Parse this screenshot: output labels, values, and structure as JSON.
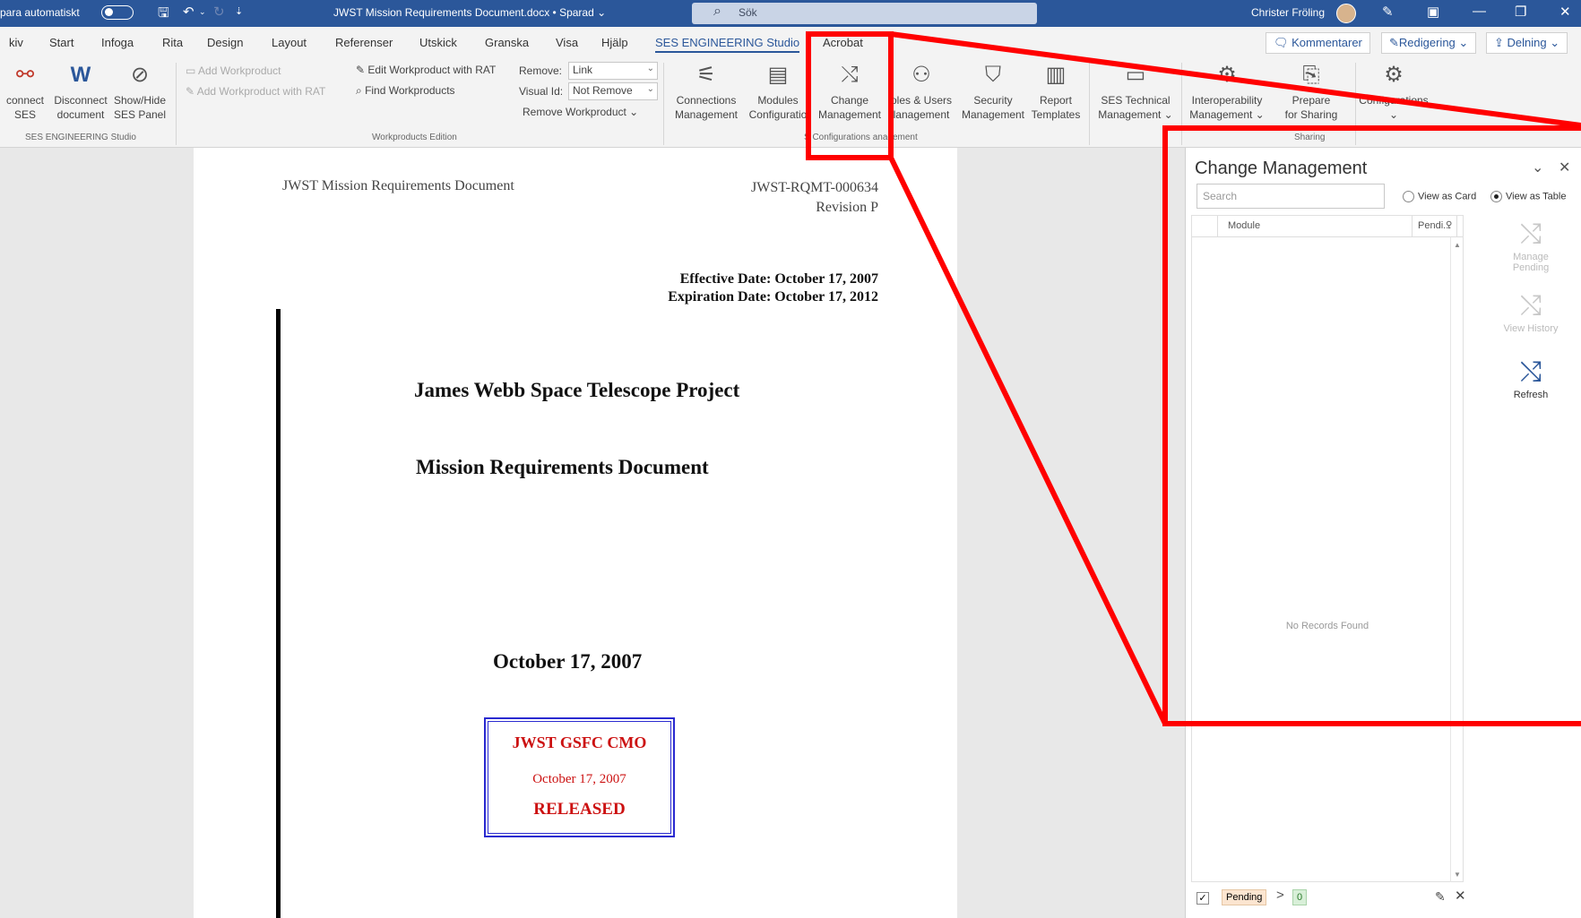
{
  "titlebar": {
    "autosave": "para automatiskt",
    "doc_title": "JWST Mission Requirements Document.docx • Sparad",
    "search_placeholder": "Sök",
    "user": "Christer Fröling"
  },
  "tabs": [
    "kiv",
    "Start",
    "Infoga",
    "Rita",
    "Design",
    "Layout",
    "Referenser",
    "Utskick",
    "Granska",
    "Visa",
    "Hjälp",
    "SES ENGINEERING Studio",
    "Acrobat"
  ],
  "tab_buttons": {
    "comments": "Kommentarer",
    "editing": "Redigering",
    "share": "Delning"
  },
  "ribbon": {
    "ses_group": {
      "buttons": [
        {
          "l1": "connect",
          "l2": "SES"
        },
        {
          "l1": "Disconnect",
          "l2": "document"
        },
        {
          "l1": "Show/Hide",
          "l2": "SES Panel"
        }
      ],
      "label": "SES ENGINEERING Studio"
    },
    "workproducts": {
      "add": "Add Workproduct",
      "add_rat": "Add Workproduct with RAT",
      "edit_rat": "Edit Workproduct with RAT",
      "find": "Find Workproducts",
      "remove_label": "Remove:",
      "remove_value": "Link",
      "visual_label": "Visual Id:",
      "visual_value": "Not Remove",
      "remove_wp": "Remove Workproduct",
      "label": "Workproducts Edition"
    },
    "config": {
      "buttons": [
        {
          "l1": "Connections",
          "l2": "Management"
        },
        {
          "l1": "Modules",
          "l2": "Configuratio"
        },
        {
          "l1": "Change",
          "l2": "Management"
        },
        {
          "l1": "oles & Users",
          "l2": "lanagement"
        },
        {
          "l1": "Security",
          "l2": "Management"
        },
        {
          "l1": "Report",
          "l2": "Templates"
        }
      ],
      "label": "SES Configurations Management",
      "label_visible": "S Configurations   anagement"
    },
    "tech": {
      "l1": "SES Technical",
      "l2": "Management"
    },
    "interop": {
      "l1": "Interoperability",
      "l2": "Management"
    },
    "sharing": {
      "l1": "Prepare",
      "l2": "for Sharing",
      "label": "Sharing"
    },
    "configurations": "Configurations"
  },
  "document": {
    "header_left": "JWST Mission Requirements Document",
    "doc_id": "JWST-RQMT-000634",
    "revision": "Revision P",
    "effective": "Effective Date: October 17, 2007",
    "expiration": "Expiration Date: October 17, 2012",
    "project": "James Webb Space Telescope Project",
    "doc_name": "Mission Requirements Document",
    "date": "October 17, 2007",
    "stamp": {
      "org": "JWST GSFC CMO",
      "date": "October 17, 2007",
      "status": "RELEASED"
    }
  },
  "panel": {
    "title": "Change Management",
    "search_placeholder": "Search",
    "view_card": "View as Card",
    "view_table": "View as Table",
    "view_selected": "table",
    "columns": [
      "Module",
      "Pendi..."
    ],
    "empty": "No Records Found",
    "actions": [
      {
        "l1": "Manage",
        "l2": "Pending",
        "enabled": false
      },
      {
        "l1": "View History",
        "l2": "",
        "enabled": false
      },
      {
        "l1": "Refresh",
        "l2": "",
        "enabled": true
      }
    ],
    "filter": {
      "label": "Pending",
      "count": "0"
    }
  },
  "colors": {
    "brand": "#2b579a",
    "annotation": "#ff0000",
    "stamp_text": "#cc1111",
    "stamp_border": "#2a2ad0"
  }
}
